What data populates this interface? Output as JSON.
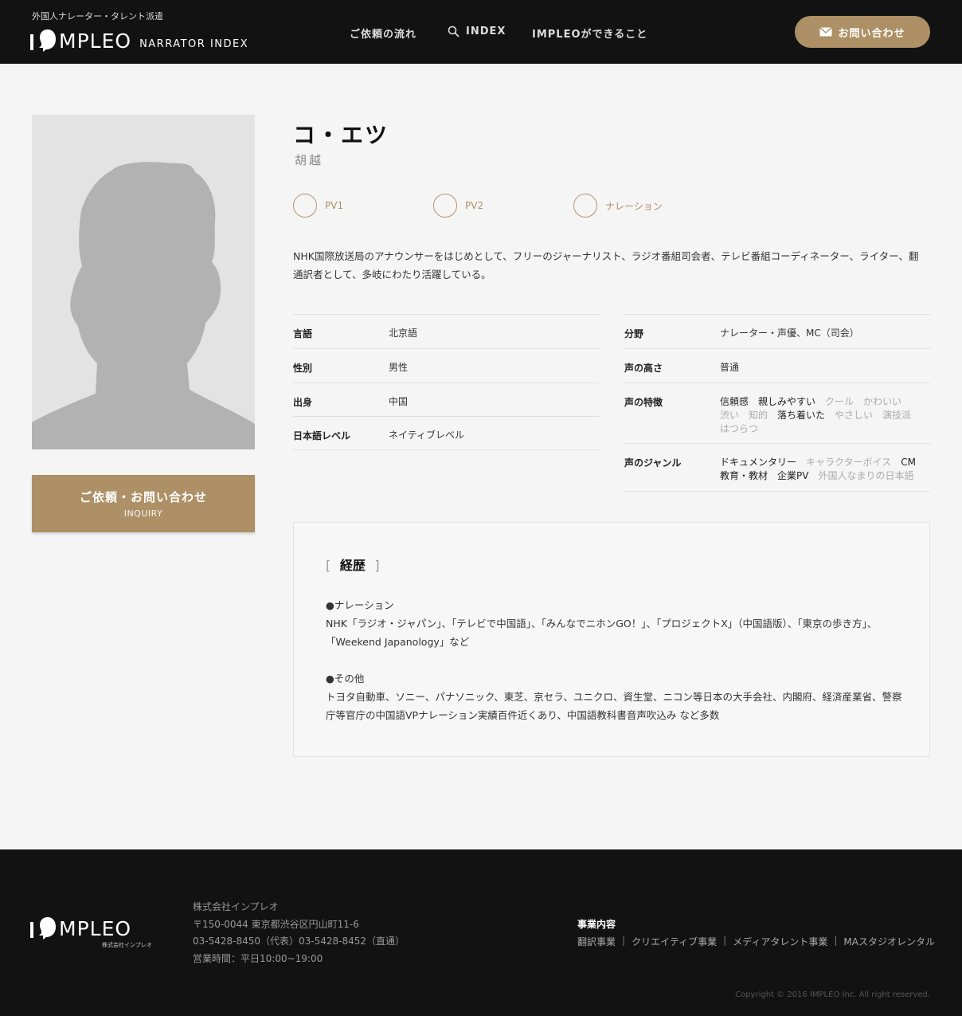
{
  "header": {
    "tagline": "外国人ナレーター・タレント派遣",
    "logo_text": "MPLEO",
    "logo_sub": "NARRATOR INDEX",
    "nav": [
      {
        "label": "ご依頼の流れ"
      },
      {
        "label": "INDEX",
        "icon": "search-icon"
      },
      {
        "label": "IMPLEOができること"
      }
    ],
    "contact_label": "お問い合わせ",
    "contact_icon": "mail-icon"
  },
  "inquiry": {
    "label": "ご依頼・お問い合わせ",
    "sub": "INQUIRY"
  },
  "profile": {
    "name": "コ・エツ",
    "name_kanji": "胡越",
    "samples": [
      "PV1",
      "PV2",
      "ナレーション"
    ],
    "description": "NHK国際放送局のアナウンサーをはじめとして、フリーのジャーナリスト、ラジオ番組司会者、テレビ番組コーディネーター、ライター、翻通訳者として、多岐にわたり活躍している。"
  },
  "info_left": [
    {
      "key": "言語",
      "value": "北京語"
    },
    {
      "key": "性別",
      "value": "男性"
    },
    {
      "key": "出身",
      "value": "中国"
    },
    {
      "key": "日本語レベル",
      "value": "ネイティブレベル"
    }
  ],
  "info_right": {
    "field": {
      "key": "分野",
      "value": "ナレーター・声優、MC（司会）"
    },
    "pitch": {
      "key": "声の高さ",
      "value": "普通"
    },
    "features": {
      "key": "声の特徴",
      "tags": [
        {
          "label": "信頼感",
          "active": true
        },
        {
          "label": "親しみやすい",
          "active": true
        },
        {
          "label": "クール",
          "active": false
        },
        {
          "label": "かわいい",
          "active": false
        },
        {
          "label": "渋い",
          "active": false
        },
        {
          "label": "知的",
          "active": false
        },
        {
          "label": "落ち着いた",
          "active": true
        },
        {
          "label": "やさしい",
          "active": false
        },
        {
          "label": "演技派",
          "active": false
        },
        {
          "label": "はつらつ",
          "active": false
        }
      ]
    },
    "genres": {
      "key": "声のジャンル",
      "tags": [
        {
          "label": "ドキュメンタリー",
          "active": true
        },
        {
          "label": "キャラクターボイス",
          "active": false
        },
        {
          "label": "CM",
          "active": true
        },
        {
          "label": "教育・教材",
          "active": true
        },
        {
          "label": "企業PV",
          "active": true
        },
        {
          "label": "外国人なまりの日本語",
          "active": false
        }
      ]
    }
  },
  "career": {
    "bracket_open": "[",
    "title": "経歴",
    "bracket_close": "]",
    "narration_head": "●ナレーション",
    "narration_body": "NHK「ラジオ・ジャパン」、「テレビで中国語」、「みんなでニホンGO！」、「プロジェクトX」（中国語版）、「東京の歩き方」、「Weekend Japanology」など",
    "other_head": "●その他",
    "other_body": "トヨタ自動車、ソニー、パナソニック、東芝、京セラ、ユニクロ、資生堂、ニコン等日本の大手会社、内閣府、経済産業省、警察庁等官庁の中国語VPナレーション実績百件近くあり、中国語教科書音声吹込み など多数"
  },
  "footer": {
    "logo_text": "MPLEO",
    "logo_sub": "株式会社インプレオ",
    "company": "株式会社インプレオ",
    "address": "〒150-0044 東京都渋谷区円山町11-6",
    "phone": "03-5428-8450（代表）03-5428-8452（直通）",
    "hours": "営業時間：平日10:00~19:00",
    "biz_title": "事業内容",
    "biz_links": [
      "翻訳事業",
      "クリエイティブ事業",
      "メディアタレント事業",
      "MAスタジオレンタル"
    ],
    "separator": "|",
    "copyright": "Copyright © 2016 IMPLEO Inc. All right reserved."
  },
  "colors": {
    "accent": "#ad9066",
    "header_bg": "#121212",
    "page_bg": "#f5f5f5"
  }
}
